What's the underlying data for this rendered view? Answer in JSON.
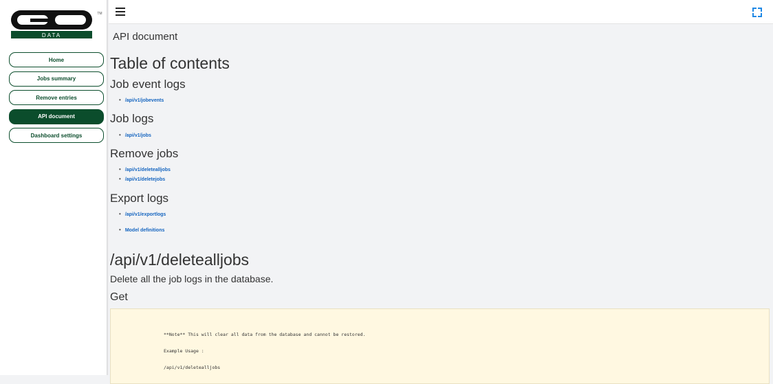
{
  "logo": {
    "text_top": "GO",
    "text_bottom": "DATA",
    "tm": "TM"
  },
  "sidebar": {
    "items": [
      {
        "label": "Home",
        "active": false
      },
      {
        "label": "Jobs summary",
        "active": false
      },
      {
        "label": "Remove entries",
        "active": false
      },
      {
        "label": "API document",
        "active": true
      },
      {
        "label": "Dashboard settings",
        "active": false
      }
    ]
  },
  "header": {
    "menu_icon": "hamburger-icon",
    "fullscreen_icon": "fullscreen-icon"
  },
  "colors": {
    "brand_green": "#0b4d2c",
    "link_blue": "#1565c0",
    "code_bg": "#fff8e1"
  },
  "main": {
    "page_title": "API document",
    "toc_title": "Table of contents",
    "sections": [
      {
        "title": "Job event logs",
        "links": [
          "/api/v1/jobevents"
        ]
      },
      {
        "title": "Job logs",
        "links": [
          "/api/v1/jobs"
        ]
      },
      {
        "title": "Remove jobs",
        "links": [
          "/api/v1/deletealljobs",
          "/api/v1/deletejobs"
        ]
      },
      {
        "title": "Export logs",
        "links": [
          "/api/v1/exportlogs"
        ]
      }
    ],
    "model_link": "Model definitions",
    "endpoint": {
      "title": "/api/v1/deletealljobs",
      "description": "Delete all the job logs in the database.",
      "method": "Get",
      "code_lines": [
        "**Note** This will clear all data from the database and cannot be restored.",
        "Example Usage :",
        "/api/v1/deletealljobs"
      ]
    }
  }
}
